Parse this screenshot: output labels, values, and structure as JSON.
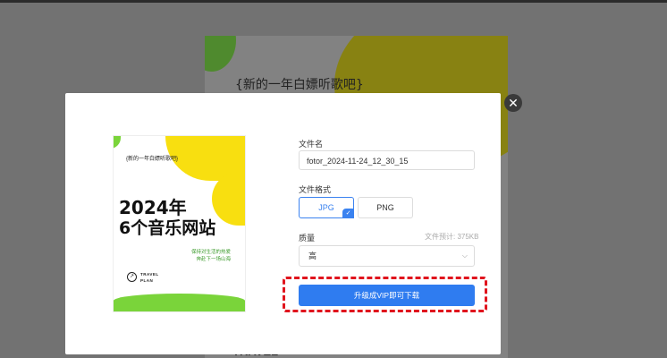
{
  "background": {
    "title": "{新的一年白嫖听歌吧}",
    "footer_text": "TRAVEL"
  },
  "modal": {
    "close_glyph": "✕",
    "preview": {
      "subtitle": "{新的一年白嫖听歌吧}",
      "headline1": "2024年",
      "headline2": "6个音乐网站",
      "tagline1": "保持对生活的热爱",
      "tagline2": "奔赴下一场山海",
      "travel1": "TRAVEL",
      "travel2": "PLAN"
    },
    "filename_label": "文件名",
    "filename_value": "fotor_2024-11-24_12_30_15",
    "format_label": "文件格式",
    "formats": [
      "JPG",
      "PNG"
    ],
    "selected_format": "JPG",
    "quality_label": "质量",
    "size_hint": "文件预计: 375KB",
    "quality_value": "高",
    "download_button": "升级成VIP即可下载"
  },
  "colors": {
    "accent": "#2f7cf0",
    "highlight": "#e0141d",
    "poster_yellow": "#f8df10",
    "poster_green": "#7ad43a"
  }
}
